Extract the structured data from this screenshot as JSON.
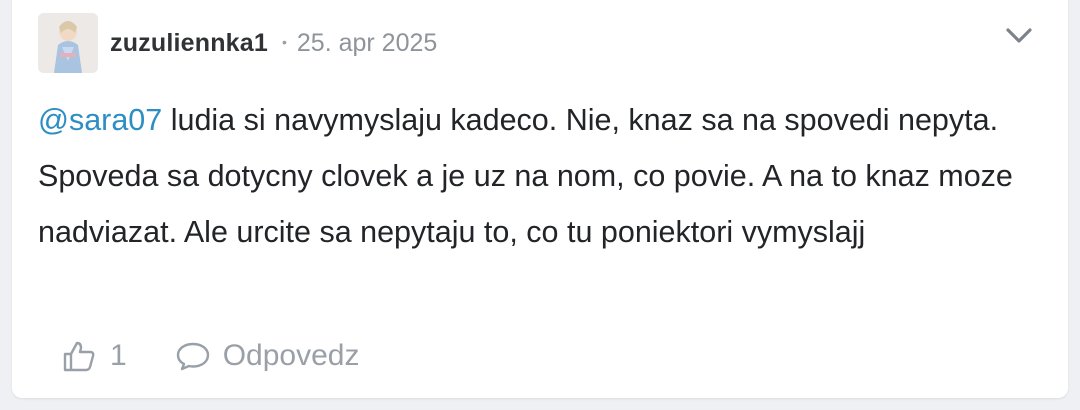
{
  "comment": {
    "author": "zuzuliennka1",
    "separator": "•",
    "date": "25. apr 2025",
    "mention": "@sara07",
    "text": " ludia si navymyslaju kadeco. Nie, knaz sa na spovedi nepyta. Spoveda sa dotycny clovek a je uz na nom, co povie. A na to knaz moze nadviazat. Ale urcite sa nepytaju to, co tu poniektori vymyslajj",
    "like_count": "1",
    "reply_label": "Odpovedz"
  },
  "icons": {
    "menu": "chevron-down-icon",
    "like": "thumbs-up-icon",
    "reply": "speech-bubble-icon"
  },
  "colors": {
    "mention": "#2d8ec4",
    "muted": "#9aa0a8",
    "text": "#222428",
    "background": "#eef0f3"
  }
}
